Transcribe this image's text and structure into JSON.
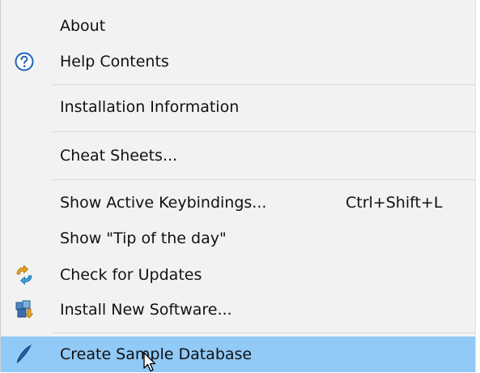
{
  "help_menu": {
    "items": [
      {
        "label": "About"
      },
      {
        "label": "Help Contents",
        "icon": "help-circle-icon"
      },
      {
        "label": "Installation Information"
      },
      {
        "label": "Cheat Sheets..."
      },
      {
        "label": "Show Active Keybindings...",
        "shortcut": "Ctrl+Shift+L"
      },
      {
        "label": "Show \"Tip of the day\""
      },
      {
        "label": "Check for Updates",
        "icon": "update-arrows-icon"
      },
      {
        "label": "Install New Software...",
        "icon": "install-software-icon"
      },
      {
        "label": "Create Sample Database",
        "icon": "quill-pen-icon",
        "selected": true
      }
    ]
  },
  "colors": {
    "menu_background": "#f2f2f2",
    "highlight": "#91c9f7",
    "separator": "#d9d9d9",
    "text": "#111111",
    "help_icon_blue": "#1f64b9"
  }
}
